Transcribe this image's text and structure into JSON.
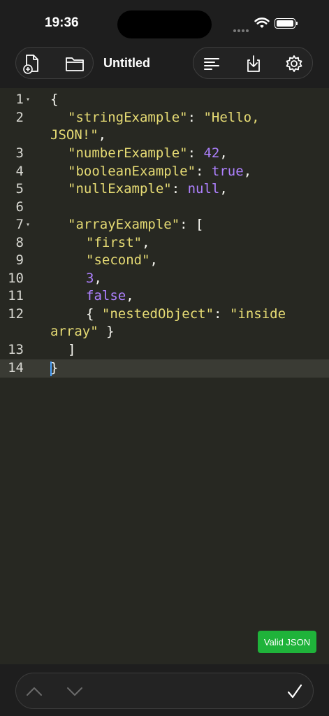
{
  "status_bar": {
    "time": "19:36"
  },
  "toolbar": {
    "title": "Untitled"
  },
  "editor": {
    "lines": [
      {
        "num": "1",
        "fold": "▾"
      },
      {
        "num": "2"
      },
      {
        "num": "3"
      },
      {
        "num": "4"
      },
      {
        "num": "5"
      },
      {
        "num": "6"
      },
      {
        "num": "7",
        "fold": "▾"
      },
      {
        "num": "8"
      },
      {
        "num": "9"
      },
      {
        "num": "10"
      },
      {
        "num": "11"
      },
      {
        "num": "12"
      },
      {
        "num": "13"
      },
      {
        "num": "14"
      }
    ],
    "code": {
      "l1": "{",
      "l2a_key": "\"stringExample\"",
      "l2a_sep": ": ",
      "l2a_val": "\"Hello,",
      "l2b_val": "JSON!\"",
      "l2b_sep": ",",
      "l3_key": "\"numberExample\"",
      "l3_sep": ": ",
      "l3_val": "42",
      "l3_end": ",",
      "l4_key": "\"booleanExample\"",
      "l4_sep": ": ",
      "l4_val": "true",
      "l4_end": ",",
      "l5_key": "\"nullExample\"",
      "l5_sep": ": ",
      "l5_val": "null",
      "l5_end": ",",
      "l7_key": "\"arrayExample\"",
      "l7_sep": ": [",
      "l8_val": "\"first\"",
      "l8_end": ",",
      "l9_val": "\"second\"",
      "l9_end": ",",
      "l10_val": "3",
      "l10_end": ",",
      "l11_val": "false",
      "l11_end": ",",
      "l12a_open": "{ ",
      "l12a_key": "\"nestedObject\"",
      "l12a_sep": ": ",
      "l12a_val": "\"inside",
      "l12b_val": "array\"",
      "l12b_end": " }",
      "l13": "]",
      "l14": "}"
    }
  },
  "validation": {
    "label": "Valid JSON",
    "color": "#1fb33a"
  },
  "theme": {
    "background": "#272822",
    "string": "#e6db74",
    "number": "#ae81ff",
    "bars": "#1e1e1e"
  }
}
